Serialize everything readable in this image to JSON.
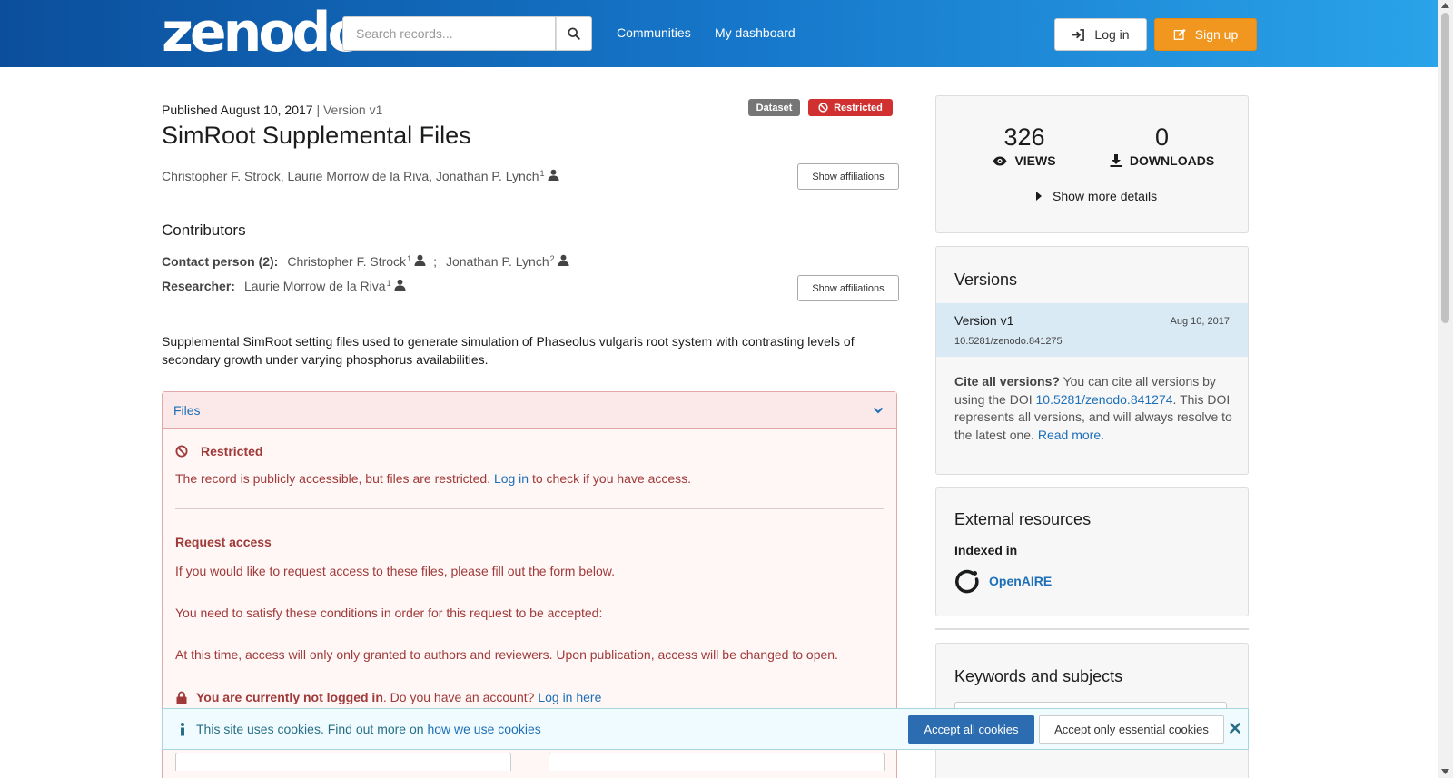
{
  "header": {
    "logo": "zenodo",
    "search_placeholder": "Search records...",
    "nav": [
      "Communities",
      "My dashboard"
    ],
    "login_label": "Log in",
    "signup_label": "Sign up"
  },
  "record": {
    "published": "Published August 10, 2017",
    "version": "| Version v1",
    "badge_type": "Dataset",
    "badge_access": "Restricted",
    "title": "SimRoot Supplemental Files",
    "authors": "Christopher F. Strock, Laurie Morrow de la Riva, Jonathan P. Lynch",
    "authors_sup": "1",
    "show_affiliations": "Show affiliations",
    "contributors_heading": "Contributors",
    "contact_label": "Contact person (2):",
    "contact_1": "Christopher F. Strock",
    "contact_1_sup": "1",
    "contact_sep": ";",
    "contact_2": "Jonathan P. Lynch",
    "contact_2_sup": "2",
    "researcher_label": "Researcher:",
    "researcher": "Laurie Morrow de la Riva",
    "researcher_sup": "1",
    "description": "Supplemental SimRoot setting files used to generate simulation of Phaseolus vulgaris root system with contrasting levels of secondary growth under varying phosphorus availabilities."
  },
  "files": {
    "heading": "Files",
    "restricted_title": "Restricted",
    "restricted_text": "The record is publicly accessible, but files are restricted.",
    "restricted_link": "Log in",
    "restricted_tail": "to check if you have access.",
    "request_title": "Request access",
    "request_text": "If you would like to request access to these files, please fill out the form below.",
    "conditions_text": "You need to satisfy these conditions in order for this request to be accepted:",
    "policy_text": "At this time, access will only only granted to authors and reviewers. Upon publication, access will be changed to open.",
    "not_logged_bold": "You are currently not logged in",
    "not_logged_text": ". Do you have an account?",
    "not_logged_link": "Log in here"
  },
  "stats": {
    "views": "326",
    "views_label": "VIEWS",
    "downloads": "0",
    "downloads_label": "DOWNLOADS",
    "more": "Show more details"
  },
  "versions": {
    "heading": "Versions",
    "item_label": "Version v1",
    "item_date": "Aug 10, 2017",
    "item_doi": "10.5281/zenodo.841275",
    "cite_bold": "Cite all versions?",
    "cite_text_1": "You can cite all versions by using the DOI",
    "cite_doi": "10.5281/zenodo.841274",
    "cite_text_2": ". This DOI represents all versions, and will always resolve to the latest one.",
    "read_more": "Read more."
  },
  "external": {
    "heading": "External resources",
    "indexed": "Indexed in",
    "openaire": "OpenAIRE"
  },
  "keywords": {
    "heading": "Keywords and subjects"
  },
  "cookie": {
    "text": "This site uses cookies. Find out more on",
    "link": "how we use cookies",
    "accept_all": "Accept all cookies",
    "accept_essential": "Accept only essential cookies"
  },
  "colors": {
    "header_start": "#0b4f9c",
    "header_end": "#2aa4ea",
    "signup": "#f1961f",
    "restricted": "#d03030",
    "dataset": "#767676",
    "link": "#1d6fb8"
  }
}
